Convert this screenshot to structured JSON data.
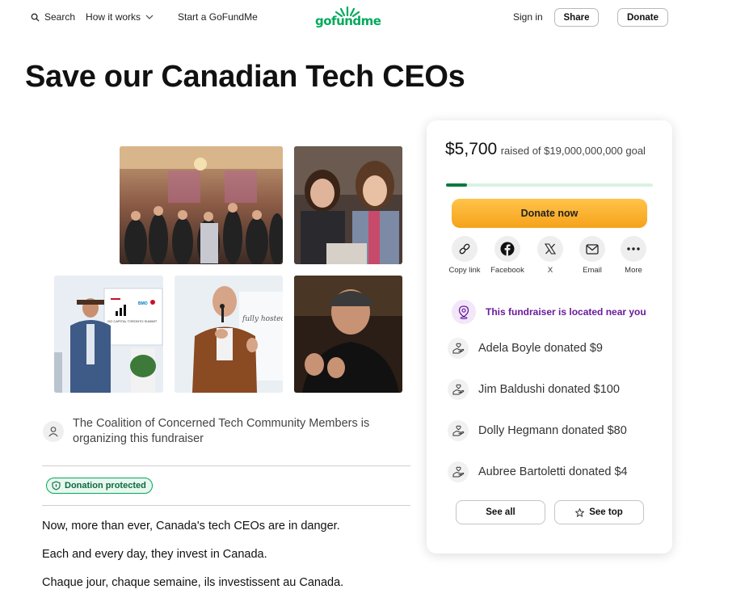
{
  "header": {
    "search_label": "Search",
    "how_it_works_label": "How it works",
    "start_label": "Start a GoFundMe",
    "logo_text": "gofundme",
    "signin_label": "Sign in",
    "share_label": "Share",
    "donate_label": "Donate"
  },
  "campaign": {
    "title": "Save our Canadian Tech CEOs",
    "organizer_text": "The Coalition of Concerned Tech Community Members is organizing this fundraiser",
    "protected_label": "Donation protected",
    "story": [
      "Now, more than ever, Canada's tech CEOs are in danger.",
      "Each and every day, they invest in Canada.",
      "Chaque jour, chaque semaine, ils investissent au Canada."
    ],
    "photo_signage": {
      "banner_title": "GO CAPITAL TORONTO SUMMIT",
      "sponsor_label": "BMO",
      "backdrop_text": "fully hosted by"
    }
  },
  "donation_card": {
    "amount_raised": "$5,700",
    "raised_of_text": "raised of $19,000,000,000 goal",
    "progress_fraction": 0.1,
    "donate_now_label": "Donate now",
    "share_options": [
      {
        "label": "Copy link",
        "icon": "link-icon"
      },
      {
        "label": "Facebook",
        "icon": "facebook-icon"
      },
      {
        "label": "X",
        "icon": "x-icon"
      },
      {
        "label": "Email",
        "icon": "email-icon"
      },
      {
        "label": "More",
        "icon": "more-icon"
      }
    ],
    "location_text": "This fundraiser is located near you",
    "donations": [
      "Adela Boyle donated $9",
      "Jim Baldushi donated $100",
      "Dolly Hegmann donated $80",
      "Aubree Bartoletti donated $4"
    ],
    "see_all_label": "See all",
    "see_top_label": "See top"
  },
  "colors": {
    "brand_green": "#02a95c",
    "donate_orange": "#f6a21a",
    "location_purple": "#6a1b9a"
  }
}
